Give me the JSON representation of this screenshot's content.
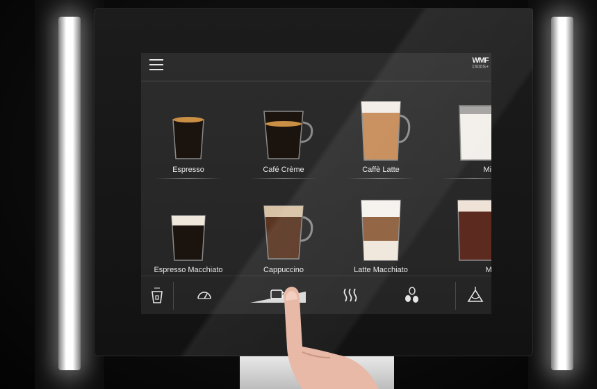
{
  "header": {
    "menu_icon": "hamburger-icon",
    "brand": "WMF",
    "model": "1500S+"
  },
  "beverages": [
    {
      "label": "Espresso",
      "cup": "espresso-cup-icon",
      "colors": {
        "top": "#c98f45",
        "body": "#1b130e"
      }
    },
    {
      "label": "Café Crème",
      "cup": "cafe-creme-cup-icon",
      "colors": {
        "top": "#c98f45",
        "body": "#1b130e"
      }
    },
    {
      "label": "Caffè Latte",
      "cup": "caffe-latte-glass-icon",
      "colors": {
        "top": "#f2ede6",
        "body": "#c68a55"
      }
    },
    {
      "label": "Milk",
      "cup": "milk-glass-icon",
      "colors": {
        "top": "#f5f2ee",
        "body": "#f2efea"
      }
    },
    {
      "label": "Espresso Macchiato",
      "cup": "espresso-macchiato-cup-icon",
      "colors": {
        "top": "#efe6dc",
        "body": "#1b130e"
      }
    },
    {
      "label": "Cappuccino",
      "cup": "cappuccino-cup-icon",
      "colors": {
        "top": "#d8c2a6",
        "body": "#5a3522"
      }
    },
    {
      "label": "Latte Macchiato",
      "cup": "latte-macchiato-glass-icon",
      "colors": {
        "top": "#f5f2ee",
        "body": "#8d5d3a"
      }
    },
    {
      "label": "Milk cho",
      "cup": "milk-chocolate-glass-icon",
      "colors": {
        "top": "#efe3d8",
        "body": "#5c2a1f"
      }
    }
  ],
  "bottom_bar": {
    "items": [
      {
        "icon": "cup-size-icon"
      },
      {
        "icon": "strength-gauge-icon"
      },
      {
        "icon": "cup-volume-slider-icon"
      },
      {
        "icon": "hot-water-icon"
      },
      {
        "icon": "coffee-beans-icon"
      },
      {
        "icon": "care-alert-icon"
      }
    ]
  }
}
